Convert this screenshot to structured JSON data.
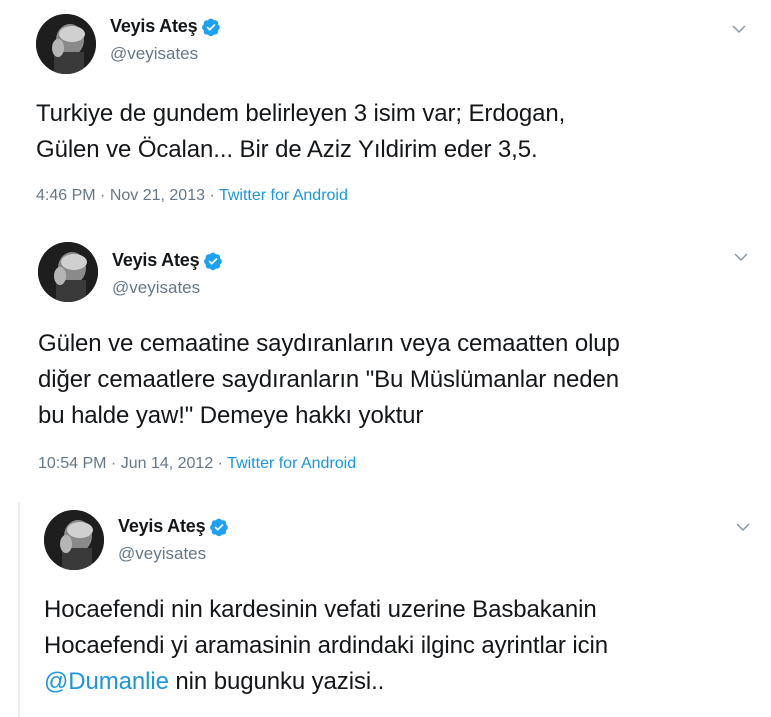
{
  "tweets": [
    {
      "name": "Veyis Ateş",
      "handle": "@veyisates",
      "text": "Turkiye de gundem belirleyen 3 isim var; Erdogan,\nGülen ve Öcalan... Bir de Aziz Yıldirim eder 3,5.",
      "time": "4:46 PM",
      "separator": " · ",
      "date": "Nov 21, 2013",
      "separator2": " · ",
      "source": "Twitter for Android"
    },
    {
      "name": "Veyis Ateş",
      "handle": "@veyisates",
      "text": "Gülen ve cemaatine saydıranların veya cemaatten olup\ndiğer cemaatlere saydıranların \"Bu Müslümanlar neden\nbu halde yaw!\" Demeye hakkı yoktur",
      "time": "10:54 PM",
      "separator": " · ",
      "date": "Jun 14, 2012",
      "separator2": " · ",
      "source": "Twitter for Android"
    },
    {
      "name": "Veyis Ateş",
      "handle": "@veyisates",
      "text_line1": "Hocaefendi nin kardesinin vefati uzerine Basbakanin",
      "text_line2": "Hocaefendi yi aramasinin ardindaki ilginc ayrintlar icin",
      "mention": "@Dumanlie",
      "text_line3_rest": " nin bugunku yazisi.."
    }
  ],
  "icons": {
    "verified": "verified-badge-icon",
    "chevron": "chevron-down-icon",
    "avatar": "profile-photo"
  },
  "colors": {
    "link": "#1b95e0",
    "muted": "#657786",
    "text": "#14171a",
    "verified": "#1da1f2"
  }
}
